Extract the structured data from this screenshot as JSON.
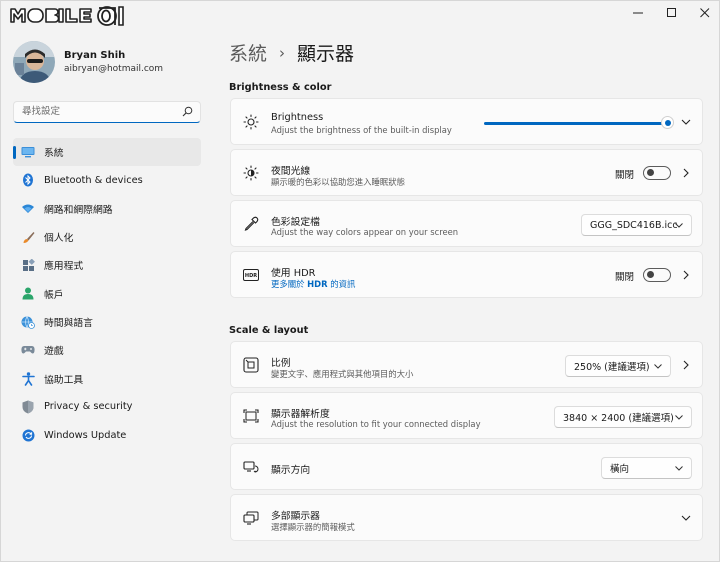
{
  "branding": {
    "logo_text": "MOBILE01"
  },
  "profile": {
    "name": "Bryan Shih",
    "email": "aibryan@hotmail.com"
  },
  "search": {
    "placeholder": "尋找設定"
  },
  "sidebar": {
    "items": [
      {
        "label": "系統",
        "icon": "monitor-icon",
        "active": true
      },
      {
        "label": "Bluetooth & devices",
        "icon": "bluetooth-icon"
      },
      {
        "label": "網路和網際網路",
        "icon": "wifi-icon"
      },
      {
        "label": "個人化",
        "icon": "brush-icon"
      },
      {
        "label": "應用程式",
        "icon": "apps-icon"
      },
      {
        "label": "帳戶",
        "icon": "person-icon"
      },
      {
        "label": "時間與語言",
        "icon": "globe-clock-icon"
      },
      {
        "label": "遊戲",
        "icon": "gamepad-icon"
      },
      {
        "label": "協助工具",
        "icon": "accessibility-icon"
      },
      {
        "label": "Privacy & security",
        "icon": "shield-icon"
      },
      {
        "label": "Windows Update",
        "icon": "update-icon"
      }
    ]
  },
  "breadcrumb": {
    "parent": "系統",
    "separator": "›",
    "current": "顯示器"
  },
  "sections": {
    "brightness_color": "Brightness & color",
    "scale_layout": "Scale & layout"
  },
  "settings": {
    "brightness": {
      "title": "Brightness",
      "subtitle": "Adjust the brightness of the built-in display",
      "level_percent": 100
    },
    "night_light": {
      "title": "夜間光線",
      "subtitle": "顯示暖的色彩以協助您進入睡眠狀態",
      "state_label": "關閉",
      "on": false
    },
    "color_profile": {
      "title": "色彩設定檔",
      "subtitle": "Adjust the way colors appear on your screen",
      "value": "GGG_SDC416B.icc"
    },
    "hdr": {
      "title": "使用 HDR",
      "link_prefix": "更多關於 ",
      "link_bold": "HDR",
      "link_suffix": " 的資訊",
      "state_label": "關閉",
      "on": false
    },
    "scale": {
      "title": "比例",
      "subtitle": "變更文字、應用程式與其他項目的大小",
      "value": "250% (建議選項)"
    },
    "resolution": {
      "title": "顯示器解析度",
      "subtitle": "Adjust the resolution to fit your connected display",
      "value": "3840 × 2400 (建議選項)"
    },
    "orientation": {
      "title": "顯示方向",
      "value": "橫向"
    },
    "multiple_displays": {
      "title": "多部顯示器",
      "subtitle": "選擇顯示器的簡報模式"
    }
  },
  "colors": {
    "accent": "#0067c0",
    "background": "#f3f3f3",
    "card": "#fbfbfb"
  }
}
